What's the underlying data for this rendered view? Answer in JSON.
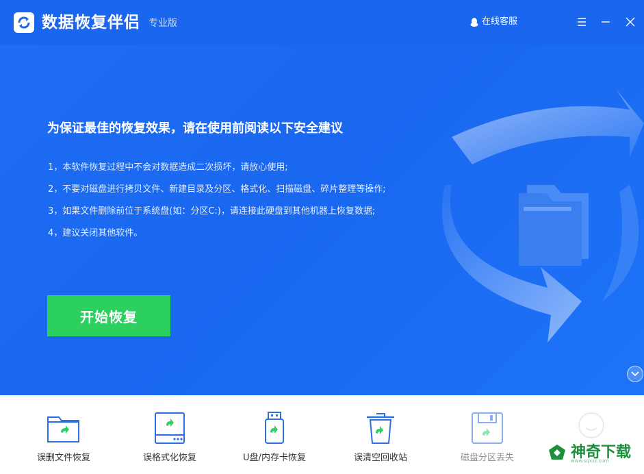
{
  "window": {
    "app_title": "数据恢复伴侣",
    "edition": "专业版",
    "support_label": "在线客服"
  },
  "main": {
    "headline": "为保证最佳的恢复效果，请在使用前阅读以下安全建议",
    "tips": [
      "1，本软件恢复过程中不会对数据造成二次损坏，请放心使用;",
      "2，不要对磁盘进行拷贝文件、新建目录及分区、格式化、扫描磁盘、碎片整理等操作;",
      "3，如果文件删除前位于系统盘(如：分区C:)，请连接此硬盘到其他机器上恢复数据;",
      "4，建议关闭其他软件。"
    ],
    "start_button": "开始恢复"
  },
  "features": [
    {
      "label": "误删文件恢复",
      "icon": "folder-restore-icon"
    },
    {
      "label": "误格式化恢复",
      "icon": "drive-restore-icon"
    },
    {
      "label": "U盘/内存卡恢复",
      "icon": "usb-restore-icon"
    },
    {
      "label": "误清空回收站",
      "icon": "recycle-bin-restore-icon"
    },
    {
      "label": "磁盘分区丢失",
      "icon": "floppy-restore-icon"
    }
  ],
  "watermark": {
    "text": "神奇下载",
    "url": "www.sqxzz.com"
  },
  "colors": {
    "brand_blue": "#1a66ef",
    "start_green": "#2bd05f",
    "icon_blue": "#2a6fe0",
    "icon_green": "#2bd05f"
  }
}
